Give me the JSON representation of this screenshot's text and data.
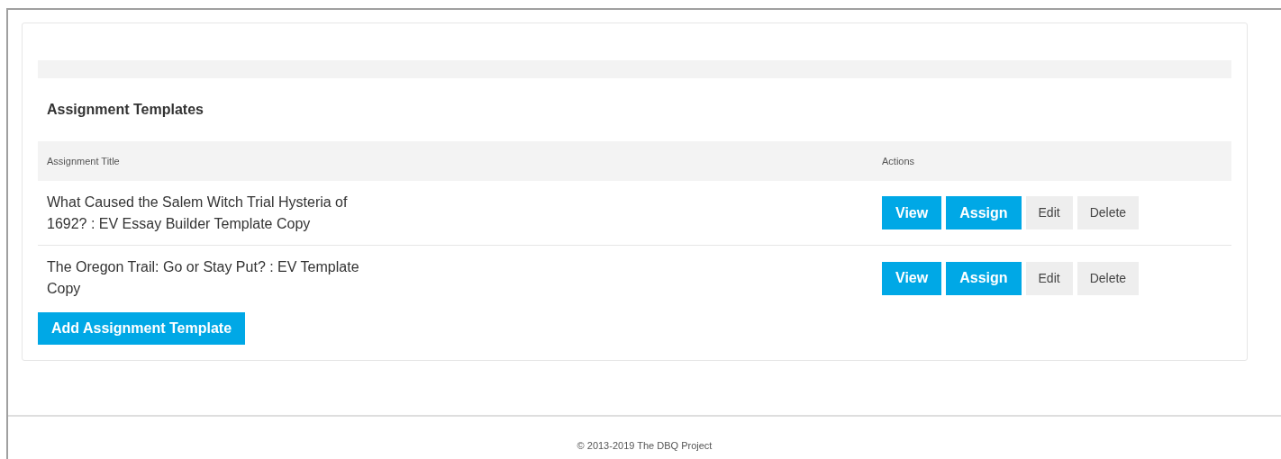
{
  "panel": {
    "title": "Assignment Templates"
  },
  "table": {
    "columns": [
      "Assignment Title",
      "Actions"
    ],
    "rows": [
      {
        "title": "What Caused the Salem Witch Trial Hysteria of 1692? : EV Essay Builder Template Copy",
        "actions": [
          {
            "label": "View",
            "kind": "primary"
          },
          {
            "label": "Assign",
            "kind": "primary"
          },
          {
            "label": "Edit",
            "kind": "secondary"
          },
          {
            "label": "Delete",
            "kind": "secondary"
          }
        ]
      },
      {
        "title": "The Oregon Trail: Go or Stay Put? : EV Template Copy",
        "actions": [
          {
            "label": "View",
            "kind": "primary"
          },
          {
            "label": "Assign",
            "kind": "primary"
          },
          {
            "label": "Edit",
            "kind": "secondary"
          },
          {
            "label": "Delete",
            "kind": "secondary"
          }
        ]
      }
    ]
  },
  "add_button": "Add Assignment Template",
  "footer": "© 2013-2019 The DBQ Project"
}
